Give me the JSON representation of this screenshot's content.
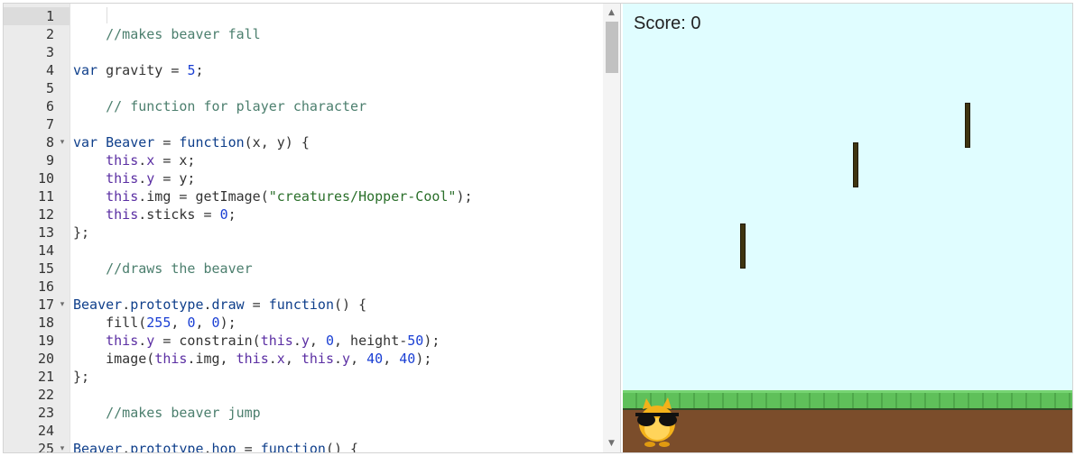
{
  "editor": {
    "lines": [
      {
        "n": "1",
        "fold": "",
        "tokens": []
      },
      {
        "n": "2",
        "fold": "",
        "tokens": [
          [
            "c",
            "    //makes beaver fall"
          ]
        ]
      },
      {
        "n": "3",
        "fold": "",
        "tokens": []
      },
      {
        "n": "4",
        "fold": "",
        "tokens": [
          [
            "k",
            "var"
          ],
          [
            "p",
            " gravity = "
          ],
          [
            "n",
            "5"
          ],
          [
            "p",
            ";"
          ]
        ]
      },
      {
        "n": "5",
        "fold": "",
        "tokens": []
      },
      {
        "n": "6",
        "fold": "",
        "tokens": [
          [
            "c",
            "    // function for player character"
          ]
        ]
      },
      {
        "n": "7",
        "fold": "",
        "tokens": []
      },
      {
        "n": "8",
        "fold": "▾",
        "tokens": [
          [
            "k",
            "var"
          ],
          [
            "p",
            " "
          ],
          [
            "k",
            "Beaver"
          ],
          [
            "p",
            " = "
          ],
          [
            "k",
            "function"
          ],
          [
            "p",
            "(x, y) {"
          ]
        ]
      },
      {
        "n": "9",
        "fold": "",
        "tokens": [
          [
            "p",
            "    "
          ],
          [
            "t",
            "this"
          ],
          [
            "p",
            "."
          ],
          [
            "t",
            "x"
          ],
          [
            "p",
            " = x;"
          ]
        ]
      },
      {
        "n": "10",
        "fold": "",
        "tokens": [
          [
            "p",
            "    "
          ],
          [
            "t",
            "this"
          ],
          [
            "p",
            "."
          ],
          [
            "t",
            "y"
          ],
          [
            "p",
            " = y;"
          ]
        ]
      },
      {
        "n": "11",
        "fold": "",
        "tokens": [
          [
            "p",
            "    "
          ],
          [
            "t",
            "this"
          ],
          [
            "p",
            ".img = getImage("
          ],
          [
            "s",
            "\"creatures/Hopper-Cool\""
          ],
          [
            "p",
            ");"
          ]
        ]
      },
      {
        "n": "12",
        "fold": "",
        "tokens": [
          [
            "p",
            "    "
          ],
          [
            "t",
            "this"
          ],
          [
            "p",
            ".sticks = "
          ],
          [
            "n",
            "0"
          ],
          [
            "p",
            ";"
          ]
        ]
      },
      {
        "n": "13",
        "fold": "",
        "tokens": [
          [
            "p",
            "};"
          ]
        ]
      },
      {
        "n": "14",
        "fold": "",
        "tokens": []
      },
      {
        "n": "15",
        "fold": "",
        "tokens": [
          [
            "c",
            "    //draws the beaver"
          ]
        ]
      },
      {
        "n": "16",
        "fold": "",
        "tokens": []
      },
      {
        "n": "17",
        "fold": "▾",
        "tokens": [
          [
            "k",
            "Beaver"
          ],
          [
            "p",
            "."
          ],
          [
            "k",
            "prototype"
          ],
          [
            "p",
            "."
          ],
          [
            "k",
            "draw"
          ],
          [
            "p",
            " = "
          ],
          [
            "k",
            "function"
          ],
          [
            "p",
            "() {"
          ]
        ]
      },
      {
        "n": "18",
        "fold": "",
        "tokens": [
          [
            "p",
            "    fill("
          ],
          [
            "n",
            "255"
          ],
          [
            "p",
            ", "
          ],
          [
            "n",
            "0"
          ],
          [
            "p",
            ", "
          ],
          [
            "n",
            "0"
          ],
          [
            "p",
            ");"
          ]
        ]
      },
      {
        "n": "19",
        "fold": "",
        "tokens": [
          [
            "p",
            "    "
          ],
          [
            "t",
            "this"
          ],
          [
            "p",
            "."
          ],
          [
            "t",
            "y"
          ],
          [
            "p",
            " = constrain("
          ],
          [
            "t",
            "this"
          ],
          [
            "p",
            "."
          ],
          [
            "t",
            "y"
          ],
          [
            "p",
            ", "
          ],
          [
            "n",
            "0"
          ],
          [
            "p",
            ", height-"
          ],
          [
            "n",
            "50"
          ],
          [
            "p",
            ");"
          ]
        ]
      },
      {
        "n": "20",
        "fold": "",
        "tokens": [
          [
            "p",
            "    image("
          ],
          [
            "t",
            "this"
          ],
          [
            "p",
            ".img, "
          ],
          [
            "t",
            "this"
          ],
          [
            "p",
            "."
          ],
          [
            "t",
            "x"
          ],
          [
            "p",
            ", "
          ],
          [
            "t",
            "this"
          ],
          [
            "p",
            "."
          ],
          [
            "t",
            "y"
          ],
          [
            "p",
            ", "
          ],
          [
            "n",
            "40"
          ],
          [
            "p",
            ", "
          ],
          [
            "n",
            "40"
          ],
          [
            "p",
            ");"
          ]
        ]
      },
      {
        "n": "21",
        "fold": "",
        "tokens": [
          [
            "p",
            "};"
          ]
        ]
      },
      {
        "n": "22",
        "fold": "",
        "tokens": []
      },
      {
        "n": "23",
        "fold": "",
        "tokens": [
          [
            "c",
            "    //makes beaver jump"
          ]
        ]
      },
      {
        "n": "24",
        "fold": "",
        "tokens": []
      },
      {
        "n": "25",
        "fold": "▾",
        "tokens": [
          [
            "k",
            "Beaver"
          ],
          [
            "p",
            "."
          ],
          [
            "k",
            "prototype"
          ],
          [
            "p",
            "."
          ],
          [
            "k",
            "hop"
          ],
          [
            "p",
            " = "
          ],
          [
            "k",
            "function"
          ],
          [
            "p",
            "() {"
          ]
        ]
      }
    ],
    "scroll_up_icon": "▲",
    "scroll_down_icon": "▼"
  },
  "canvas": {
    "score_label": "Score: 0",
    "colors": {
      "sky": "#e0fdff",
      "grass": "#5fc05a",
      "dirt": "#7b4d2b",
      "stick": "#3f3410"
    },
    "sticks_count": 3,
    "character_icon": "hopper-cool-sunglasses-creature"
  }
}
